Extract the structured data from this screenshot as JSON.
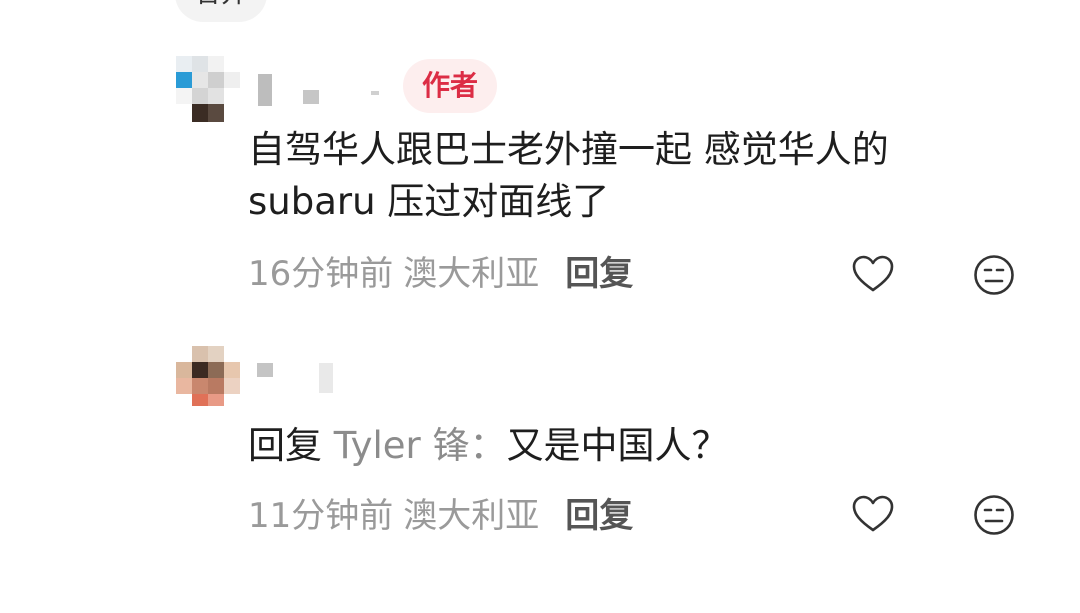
{
  "top_pill": {
    "label": "合并"
  },
  "comments": [
    {
      "author_tag": "作者",
      "body": "自驾华人跟巴士老外撞一起 感觉华人的 subaru 压过对面线了",
      "time": "16分钟前",
      "location": "澳大利亚",
      "reply_label": "回复"
    },
    {
      "reply_prefix": "回复",
      "reply_target": "Tyler 锋：",
      "body": "又是中国人？",
      "time": "11分钟前",
      "location": "澳大利亚",
      "reply_label": "回复"
    }
  ],
  "icons": {
    "like": "heart-outline-icon",
    "dislike": "neutral-face-icon"
  },
  "colors": {
    "author_tag_text": "#dc2d45",
    "author_tag_bg": "#fdeeee",
    "body_text": "#1e1e1e",
    "meta_text": "#9a9a9a",
    "reply_button": "#555555",
    "reply_target": "#8c8c8c"
  }
}
